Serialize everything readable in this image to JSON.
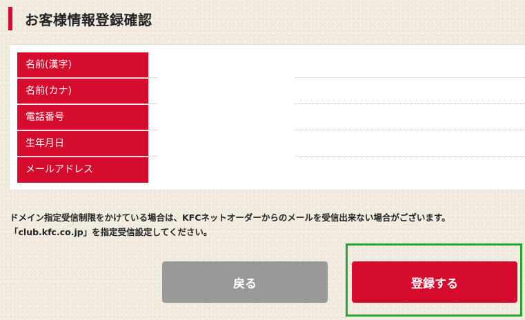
{
  "page": {
    "title": "お客様情報登録確認"
  },
  "form": {
    "rows": [
      {
        "label": "名前(漢字)",
        "value": ""
      },
      {
        "label": "名前(カナ)",
        "value": ""
      },
      {
        "label": "電話番号",
        "value": ""
      },
      {
        "label": "生年月日",
        "value": ""
      },
      {
        "label": "メールアドレス",
        "value": ""
      }
    ]
  },
  "notice": {
    "line1": "ドメイン指定受信制限をかけている場合は、KFCネットオーダーからのメールを受信出来ない場合がございます。",
    "line2": "「club.kfc.co.jp」を指定受信設定してください。"
  },
  "buttons": {
    "back_label": "戻る",
    "register_label": "登録する"
  },
  "colors": {
    "accent": "#d60c2f",
    "back_button": "#999999",
    "highlight": "#22a634",
    "background": "#f1ebe0"
  }
}
